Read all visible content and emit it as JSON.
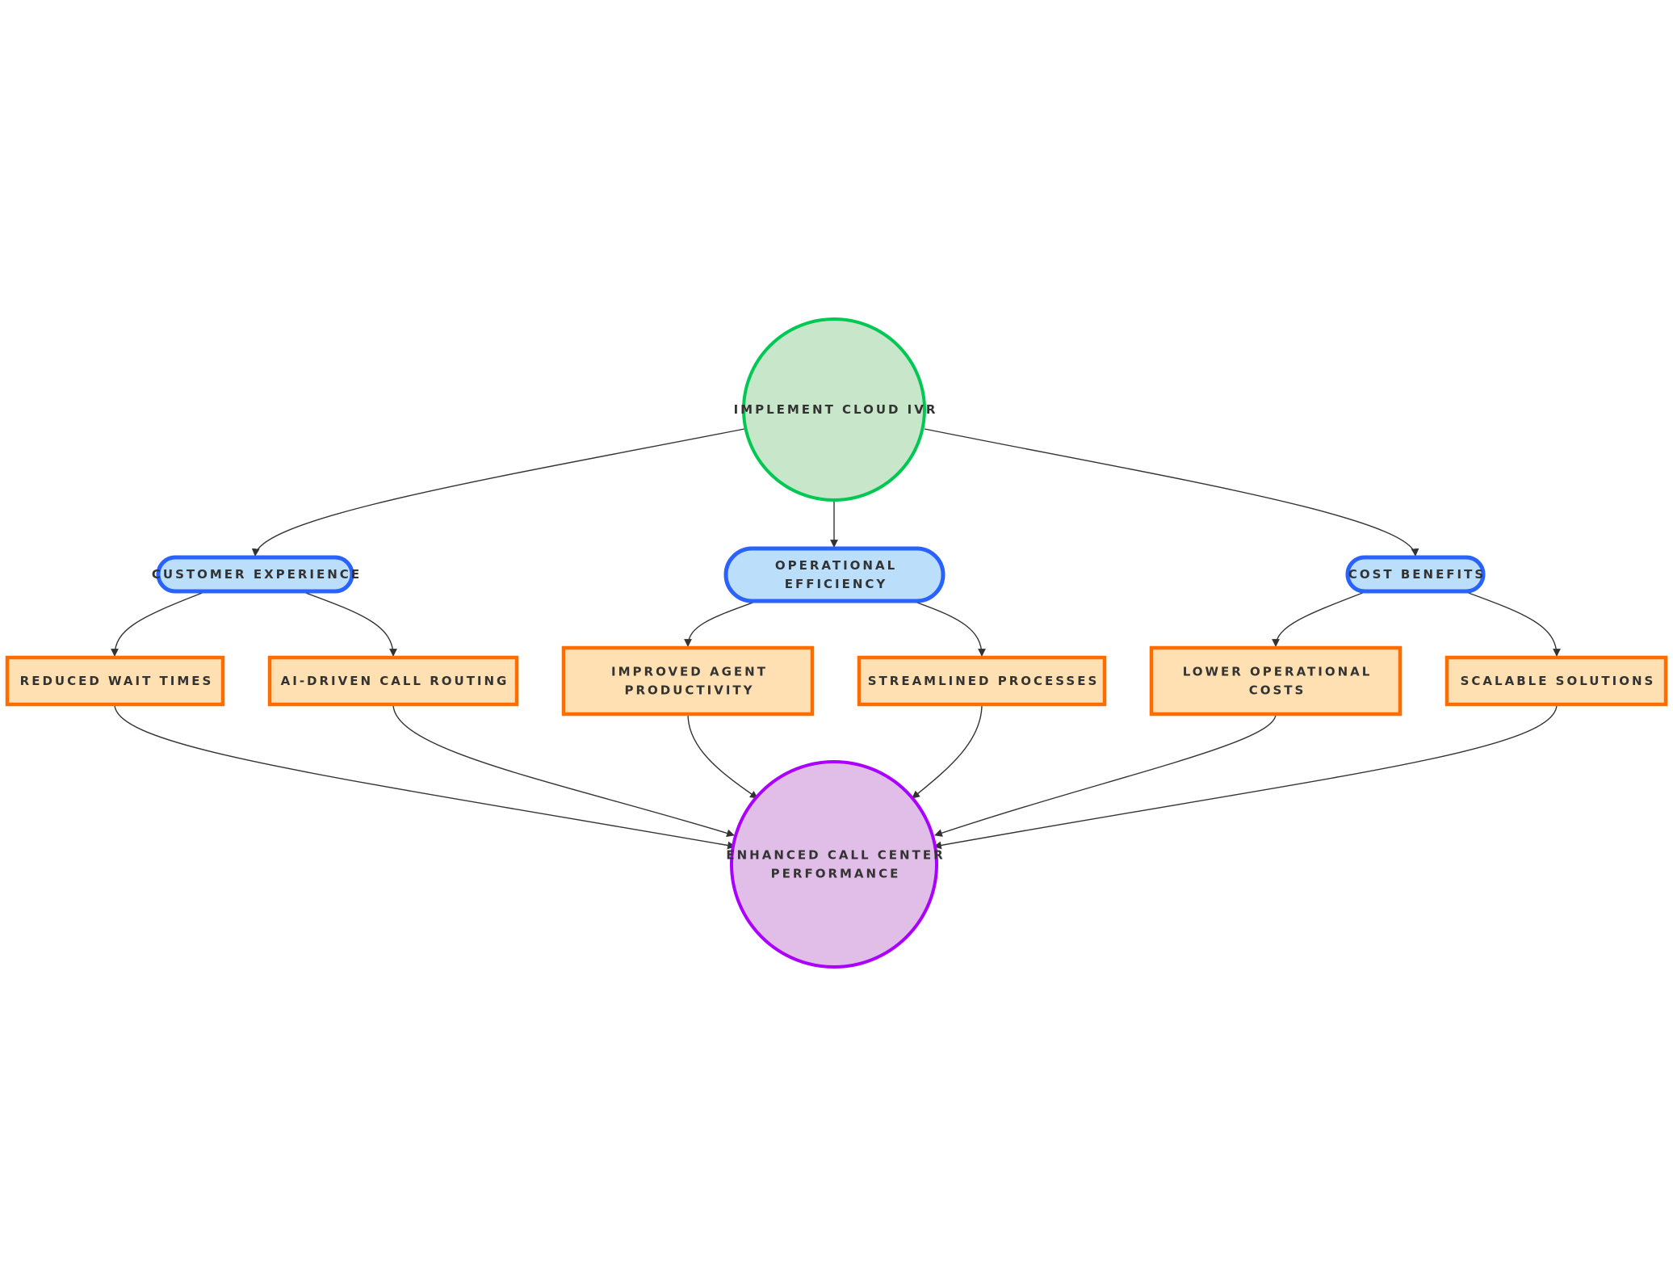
{
  "diagram": {
    "type": "flowchart",
    "colors": {
      "start_fill": "#c8e6c9",
      "start_stroke": "#00c853",
      "category_fill": "#bbdefb",
      "category_stroke": "#2962ff",
      "benefit_fill": "#ffe0b2",
      "benefit_stroke": "#ff6d00",
      "end_fill": "#e1bee7",
      "end_stroke": "#aa00ff",
      "edge": "#333333",
      "text": "#333333"
    },
    "nodes": [
      {
        "id": "start",
        "shape": "circle",
        "kind": "start",
        "lines": [
          "IMPLEMENT CLOUD IVR"
        ]
      },
      {
        "id": "cx",
        "shape": "stadium",
        "kind": "category",
        "lines": [
          "CUSTOMER EXPERIENCE"
        ]
      },
      {
        "id": "oe",
        "shape": "stadium",
        "kind": "category",
        "lines": [
          "OPERATIONAL",
          "EFFICIENCY"
        ]
      },
      {
        "id": "cb",
        "shape": "stadium",
        "kind": "category",
        "lines": [
          "COST BENEFITS"
        ]
      },
      {
        "id": "rwt",
        "shape": "rect",
        "kind": "benefit",
        "lines": [
          "REDUCED WAIT TIMES"
        ]
      },
      {
        "id": "ai",
        "shape": "rect",
        "kind": "benefit",
        "lines": [
          "AI-DRIVEN CALL ROUTING"
        ]
      },
      {
        "id": "iap",
        "shape": "rect",
        "kind": "benefit",
        "lines": [
          "IMPROVED AGENT",
          "PRODUCTIVITY"
        ]
      },
      {
        "id": "sp",
        "shape": "rect",
        "kind": "benefit",
        "lines": [
          "STREAMLINED PROCESSES"
        ]
      },
      {
        "id": "loc",
        "shape": "rect",
        "kind": "benefit",
        "lines": [
          "LOWER OPERATIONAL",
          "COSTS"
        ]
      },
      {
        "id": "ss",
        "shape": "rect",
        "kind": "benefit",
        "lines": [
          "SCALABLE SOLUTIONS"
        ]
      },
      {
        "id": "end",
        "shape": "circle",
        "kind": "end",
        "lines": [
          "ENHANCED CALL CENTER",
          "PERFORMANCE"
        ]
      }
    ],
    "edges": [
      {
        "from": "start",
        "to": "cx"
      },
      {
        "from": "start",
        "to": "oe"
      },
      {
        "from": "start",
        "to": "cb"
      },
      {
        "from": "cx",
        "to": "rwt"
      },
      {
        "from": "cx",
        "to": "ai"
      },
      {
        "from": "oe",
        "to": "iap"
      },
      {
        "from": "oe",
        "to": "sp"
      },
      {
        "from": "cb",
        "to": "loc"
      },
      {
        "from": "cb",
        "to": "ss"
      },
      {
        "from": "rwt",
        "to": "end"
      },
      {
        "from": "ai",
        "to": "end"
      },
      {
        "from": "iap",
        "to": "end"
      },
      {
        "from": "sp",
        "to": "end"
      },
      {
        "from": "loc",
        "to": "end"
      },
      {
        "from": "ss",
        "to": "end"
      }
    ]
  }
}
